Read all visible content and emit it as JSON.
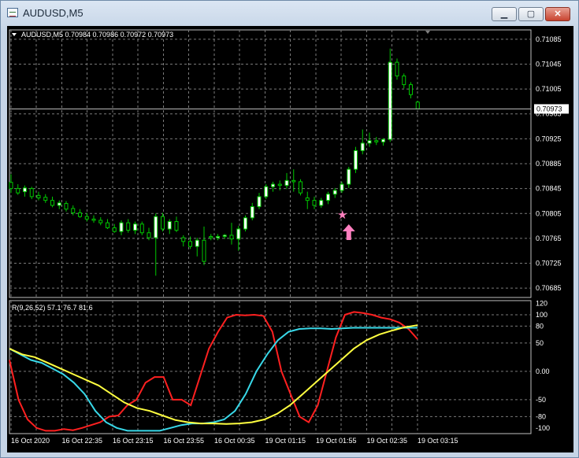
{
  "window": {
    "title": "AUDUSD,M5",
    "buttons": {
      "minimize": "▁",
      "maximize": "▢",
      "close": "✕"
    }
  },
  "colors": {
    "background": "#000000",
    "grid": "#7a7a7a",
    "axis_text": "#ffffff",
    "candle_up": "#ffffff",
    "candle_down": "#000000",
    "candle_wick": "#00c800",
    "rsi_fast": "#ff2020",
    "rsi_mid": "#38d8e8",
    "rsi_slow": "#ffff40",
    "marker": "#ff80c0"
  },
  "chart_data": [
    {
      "type": "candlestick",
      "symbol_header": "AUDUSD,M5  0.70984 0.70986 0.70972 0.70973",
      "current_price": "0.70973",
      "y_ticks": [
        "0.71085",
        "0.71045",
        "0.71005",
        "0.70965",
        "0.70925",
        "0.70885",
        "0.70845",
        "0.70805",
        "0.70765",
        "0.70725",
        "0.70685"
      ],
      "ylim": [
        0.7067,
        0.711
      ],
      "x_ticks": [
        "16 Oct 2020",
        "16 Oct 22:35",
        "16 Oct 23:15",
        "16 Oct 23:55",
        "16 Oct 00:35",
        "19 Oct 01:15",
        "19 Oct 01:55",
        "19 Oct 02:35",
        "19 Oct 03:15"
      ],
      "candles": [
        {
          "o": 0.70855,
          "h": 0.70868,
          "l": 0.70838,
          "c": 0.70845
        },
        {
          "o": 0.70845,
          "h": 0.70852,
          "l": 0.70835,
          "c": 0.70838
        },
        {
          "o": 0.7084,
          "h": 0.7085,
          "l": 0.70832,
          "c": 0.70846
        },
        {
          "o": 0.70845,
          "h": 0.70848,
          "l": 0.70828,
          "c": 0.70832
        },
        {
          "o": 0.70834,
          "h": 0.7084,
          "l": 0.70826,
          "c": 0.7083
        },
        {
          "o": 0.70831,
          "h": 0.70836,
          "l": 0.70822,
          "c": 0.70826
        },
        {
          "o": 0.70826,
          "h": 0.70832,
          "l": 0.70815,
          "c": 0.70818
        },
        {
          "o": 0.70818,
          "h": 0.70826,
          "l": 0.70812,
          "c": 0.70822
        },
        {
          "o": 0.70821,
          "h": 0.70825,
          "l": 0.70808,
          "c": 0.70812
        },
        {
          "o": 0.70813,
          "h": 0.70818,
          "l": 0.70802,
          "c": 0.70806
        },
        {
          "o": 0.70806,
          "h": 0.70812,
          "l": 0.70798,
          "c": 0.708
        },
        {
          "o": 0.708,
          "h": 0.70806,
          "l": 0.70792,
          "c": 0.70796
        },
        {
          "o": 0.70796,
          "h": 0.70802,
          "l": 0.7079,
          "c": 0.70794
        },
        {
          "o": 0.70794,
          "h": 0.70799,
          "l": 0.70786,
          "c": 0.7079
        },
        {
          "o": 0.7079,
          "h": 0.70796,
          "l": 0.7078,
          "c": 0.70782
        },
        {
          "o": 0.70782,
          "h": 0.70788,
          "l": 0.70774,
          "c": 0.70776
        },
        {
          "o": 0.70776,
          "h": 0.70794,
          "l": 0.7077,
          "c": 0.7079
        },
        {
          "o": 0.7079,
          "h": 0.70796,
          "l": 0.70774,
          "c": 0.70778
        },
        {
          "o": 0.70778,
          "h": 0.70792,
          "l": 0.70772,
          "c": 0.70788
        },
        {
          "o": 0.70788,
          "h": 0.70792,
          "l": 0.7077,
          "c": 0.70774
        },
        {
          "o": 0.70774,
          "h": 0.70782,
          "l": 0.70762,
          "c": 0.70766
        },
        {
          "o": 0.70766,
          "h": 0.70805,
          "l": 0.70705,
          "c": 0.708
        },
        {
          "o": 0.708,
          "h": 0.70806,
          "l": 0.70776,
          "c": 0.7078
        },
        {
          "o": 0.7078,
          "h": 0.70796,
          "l": 0.70772,
          "c": 0.70792
        },
        {
          "o": 0.70792,
          "h": 0.708,
          "l": 0.70775,
          "c": 0.70778
        },
        {
          "o": 0.70766,
          "h": 0.7077,
          "l": 0.70752,
          "c": 0.7076
        },
        {
          "o": 0.7076,
          "h": 0.70768,
          "l": 0.70748,
          "c": 0.70752
        },
        {
          "o": 0.70752,
          "h": 0.70766,
          "l": 0.70736,
          "c": 0.70762
        },
        {
          "o": 0.70762,
          "h": 0.70784,
          "l": 0.70722,
          "c": 0.70728
        },
        {
          "o": 0.70768,
          "h": 0.70772,
          "l": 0.70762,
          "c": 0.70766
        },
        {
          "o": 0.70766,
          "h": 0.70772,
          "l": 0.70762,
          "c": 0.70768
        },
        {
          "o": 0.70768,
          "h": 0.70772,
          "l": 0.70764,
          "c": 0.7077
        },
        {
          "o": 0.7077,
          "h": 0.7079,
          "l": 0.70755,
          "c": 0.70764
        },
        {
          "o": 0.70764,
          "h": 0.70785,
          "l": 0.70745,
          "c": 0.7078
        },
        {
          "o": 0.7078,
          "h": 0.70802,
          "l": 0.70776,
          "c": 0.70798
        },
        {
          "o": 0.70798,
          "h": 0.70822,
          "l": 0.70794,
          "c": 0.70816
        },
        {
          "o": 0.70816,
          "h": 0.70838,
          "l": 0.70812,
          "c": 0.70832
        },
        {
          "o": 0.70832,
          "h": 0.70852,
          "l": 0.70828,
          "c": 0.70848
        },
        {
          "o": 0.70848,
          "h": 0.70856,
          "l": 0.7084,
          "c": 0.70852
        },
        {
          "o": 0.70852,
          "h": 0.70858,
          "l": 0.70842,
          "c": 0.7085
        },
        {
          "o": 0.7085,
          "h": 0.7087,
          "l": 0.70844,
          "c": 0.70858
        },
        {
          "o": 0.70858,
          "h": 0.70876,
          "l": 0.7084,
          "c": 0.70856
        },
        {
          "o": 0.70856,
          "h": 0.7086,
          "l": 0.70834,
          "c": 0.70838
        },
        {
          "o": 0.7083,
          "h": 0.7084,
          "l": 0.70812,
          "c": 0.70826
        },
        {
          "o": 0.70826,
          "h": 0.70832,
          "l": 0.70812,
          "c": 0.70818
        },
        {
          "o": 0.70818,
          "h": 0.7083,
          "l": 0.70814,
          "c": 0.70826
        },
        {
          "o": 0.70826,
          "h": 0.7084,
          "l": 0.7082,
          "c": 0.70836
        },
        {
          "o": 0.70836,
          "h": 0.70846,
          "l": 0.7083,
          "c": 0.70842
        },
        {
          "o": 0.70842,
          "h": 0.70856,
          "l": 0.70838,
          "c": 0.70852
        },
        {
          "o": 0.70852,
          "h": 0.7088,
          "l": 0.70846,
          "c": 0.70876
        },
        {
          "o": 0.70876,
          "h": 0.70912,
          "l": 0.7087,
          "c": 0.70906
        },
        {
          "o": 0.70906,
          "h": 0.7094,
          "l": 0.709,
          "c": 0.70918
        },
        {
          "o": 0.70918,
          "h": 0.70935,
          "l": 0.70912,
          "c": 0.70922
        },
        {
          "o": 0.70922,
          "h": 0.70928,
          "l": 0.70915,
          "c": 0.7092
        },
        {
          "o": 0.7092,
          "h": 0.70926,
          "l": 0.70914,
          "c": 0.70924
        },
        {
          "o": 0.70924,
          "h": 0.7107,
          "l": 0.7092,
          "c": 0.71048
        },
        {
          "o": 0.71048,
          "h": 0.71054,
          "l": 0.7102,
          "c": 0.71026
        },
        {
          "o": 0.71026,
          "h": 0.7103,
          "l": 0.71006,
          "c": 0.71012
        },
        {
          "o": 0.71012,
          "h": 0.71016,
          "l": 0.7099,
          "c": 0.70996
        },
        {
          "o": 0.70984,
          "h": 0.70986,
          "l": 0.70972,
          "c": 0.70973
        }
      ],
      "markers": [
        {
          "type": "star",
          "index": 48,
          "price": 0.70803
        },
        {
          "type": "arrow-up",
          "index": 49,
          "price": 0.70775
        }
      ]
    },
    {
      "type": "line",
      "label": "R(9,26,52) 57.1 76.7 81.6",
      "y_ticks": [
        "120",
        "100",
        "80",
        "50",
        "0.00",
        "-50",
        "-80",
        "-100"
      ],
      "ylim": [
        -110,
        125
      ],
      "series": [
        {
          "name": "9",
          "values": [
            20,
            -50,
            -85,
            -100,
            -105,
            -105,
            -102,
            -104,
            -100,
            -95,
            -90,
            -80,
            -78,
            -60,
            -50,
            -20,
            -10,
            -10,
            -50,
            -50,
            -60,
            -10,
            40,
            70,
            95,
            100,
            99,
            100,
            98,
            70,
            0,
            -40,
            -80,
            -90,
            -60,
            0,
            60,
            100,
            105,
            103,
            100,
            95,
            92,
            86,
            75,
            57
          ]
        },
        {
          "name": "26",
          "values": [
            40,
            30,
            20,
            15,
            5,
            -5,
            -20,
            -40,
            -70,
            -90,
            -100,
            -105,
            -105,
            -105,
            -105,
            -100,
            -95,
            -92,
            -92,
            -90,
            -85,
            -70,
            -40,
            0,
            30,
            55,
            70,
            75,
            76,
            76,
            75,
            76,
            77,
            77,
            77,
            77,
            77,
            77,
            77
          ]
        },
        {
          "name": "52",
          "values": [
            40,
            30,
            25,
            15,
            5,
            -5,
            -15,
            -25,
            -40,
            -55,
            -65,
            -70,
            -78,
            -86,
            -90,
            -92,
            -92,
            -93,
            -92,
            -90,
            -85,
            -75,
            -60,
            -40,
            -20,
            0,
            20,
            40,
            55,
            65,
            72,
            78,
            81.6
          ]
        }
      ]
    }
  ]
}
